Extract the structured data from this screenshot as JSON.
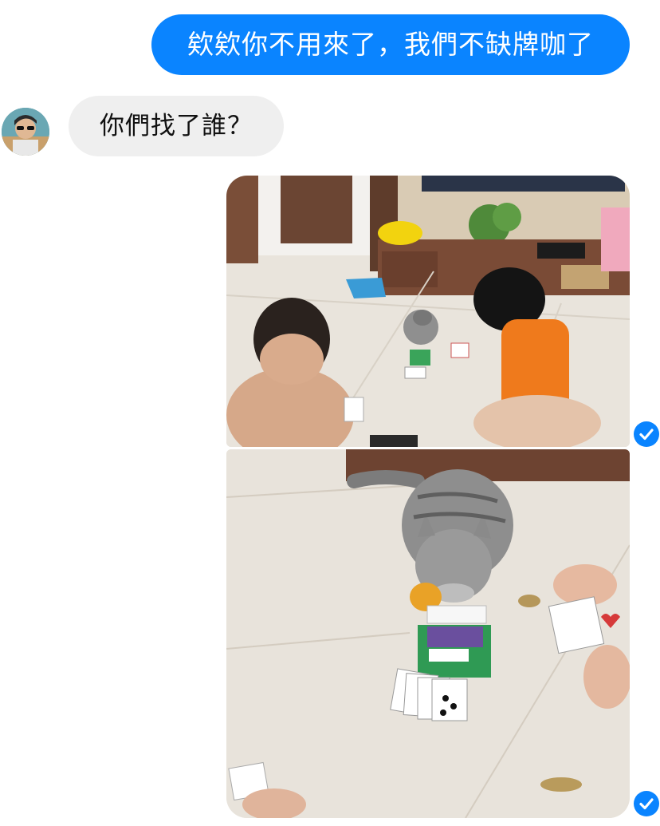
{
  "messages": [
    {
      "direction": "outgoing",
      "text": "欸欸你不用來了，我們不缺牌咖了"
    },
    {
      "direction": "incoming",
      "text": "你們找了誰？"
    }
  ],
  "photos": [
    {
      "icon": "photo-people-playing-cards-with-cat"
    },
    {
      "icon": "photo-cat-near-cards-closeup"
    }
  ],
  "status": {
    "delivered_icon": "check-circle-icon",
    "color": "#0a84ff"
  },
  "colors": {
    "outgoing_bubble": "#0a84ff",
    "incoming_bubble": "#efefef"
  }
}
